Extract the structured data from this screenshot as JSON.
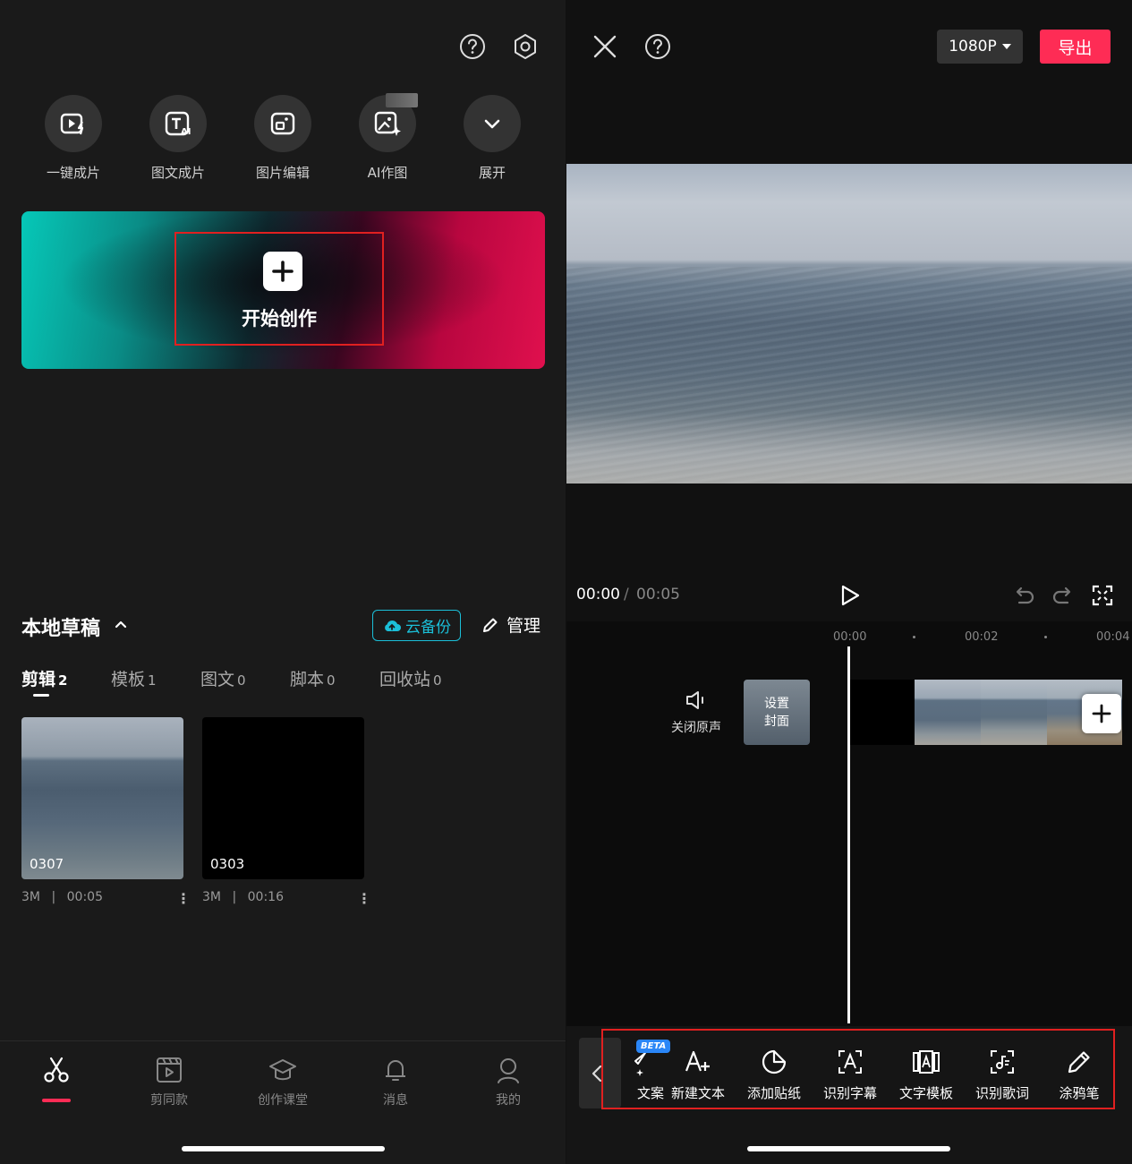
{
  "left": {
    "top_icons": [
      "help-icon",
      "settings-icon"
    ],
    "quick_actions": [
      {
        "label": "一键成片",
        "icon": "one-click-video-icon"
      },
      {
        "label": "图文成片",
        "icon": "text-to-video-icon"
      },
      {
        "label": "图片编辑",
        "icon": "image-edit-icon"
      },
      {
        "label": "AI作图",
        "icon": "ai-image-icon"
      },
      {
        "label": "展开",
        "icon": "chevron-down-icon"
      }
    ],
    "start_create_label": "开始创作",
    "drafts": {
      "title": "本地草稿",
      "cloud_backup_label": "云备份",
      "manage_label": "管理"
    },
    "tabs": [
      {
        "label": "剪辑",
        "count": "2",
        "active": true
      },
      {
        "label": "模板",
        "count": "1"
      },
      {
        "label": "图文",
        "count": "0"
      },
      {
        "label": "脚本",
        "count": "0"
      },
      {
        "label": "回收站",
        "count": "0"
      }
    ],
    "draft_cards": [
      {
        "name": "0307",
        "size": "3M",
        "duration": "00:05"
      },
      {
        "name": "0303",
        "size": "3M",
        "duration": "00:16"
      }
    ],
    "meta_separator": "|",
    "bottom_nav": [
      {
        "label": "",
        "icon": "scissors-icon",
        "active": true
      },
      {
        "label": "剪同款",
        "icon": "template-video-icon"
      },
      {
        "label": "创作课堂",
        "icon": "graduation-cap-icon"
      },
      {
        "label": "消息",
        "icon": "bell-icon"
      },
      {
        "label": "我的",
        "icon": "user-icon"
      }
    ]
  },
  "right": {
    "header": {
      "resolution": "1080P",
      "export_label": "导出"
    },
    "playback": {
      "current_time": "00:00",
      "separator": "/",
      "total_time": "00:05"
    },
    "ruler_ticks": [
      "00:00",
      "00:02",
      "00:04"
    ],
    "track": {
      "mute_label": "关闭原声",
      "cover_label_line1": "设置",
      "cover_label_line2": "封面"
    },
    "tools": [
      {
        "label": "文案",
        "icon": "ai-copywriting-icon",
        "badge": "BETA"
      },
      {
        "label": "新建文本",
        "icon": "add-text-icon"
      },
      {
        "label": "添加贴纸",
        "icon": "sticker-icon"
      },
      {
        "label": "识别字幕",
        "icon": "recognize-subtitles-icon"
      },
      {
        "label": "文字模板",
        "icon": "text-template-icon"
      },
      {
        "label": "识别歌词",
        "icon": "recognize-lyrics-icon"
      },
      {
        "label": "涂鸦笔",
        "icon": "pen-icon"
      }
    ],
    "colors": {
      "accent": "#fe2c55",
      "cloud": "#1bbfd8",
      "beta": "#2a86f7"
    }
  }
}
